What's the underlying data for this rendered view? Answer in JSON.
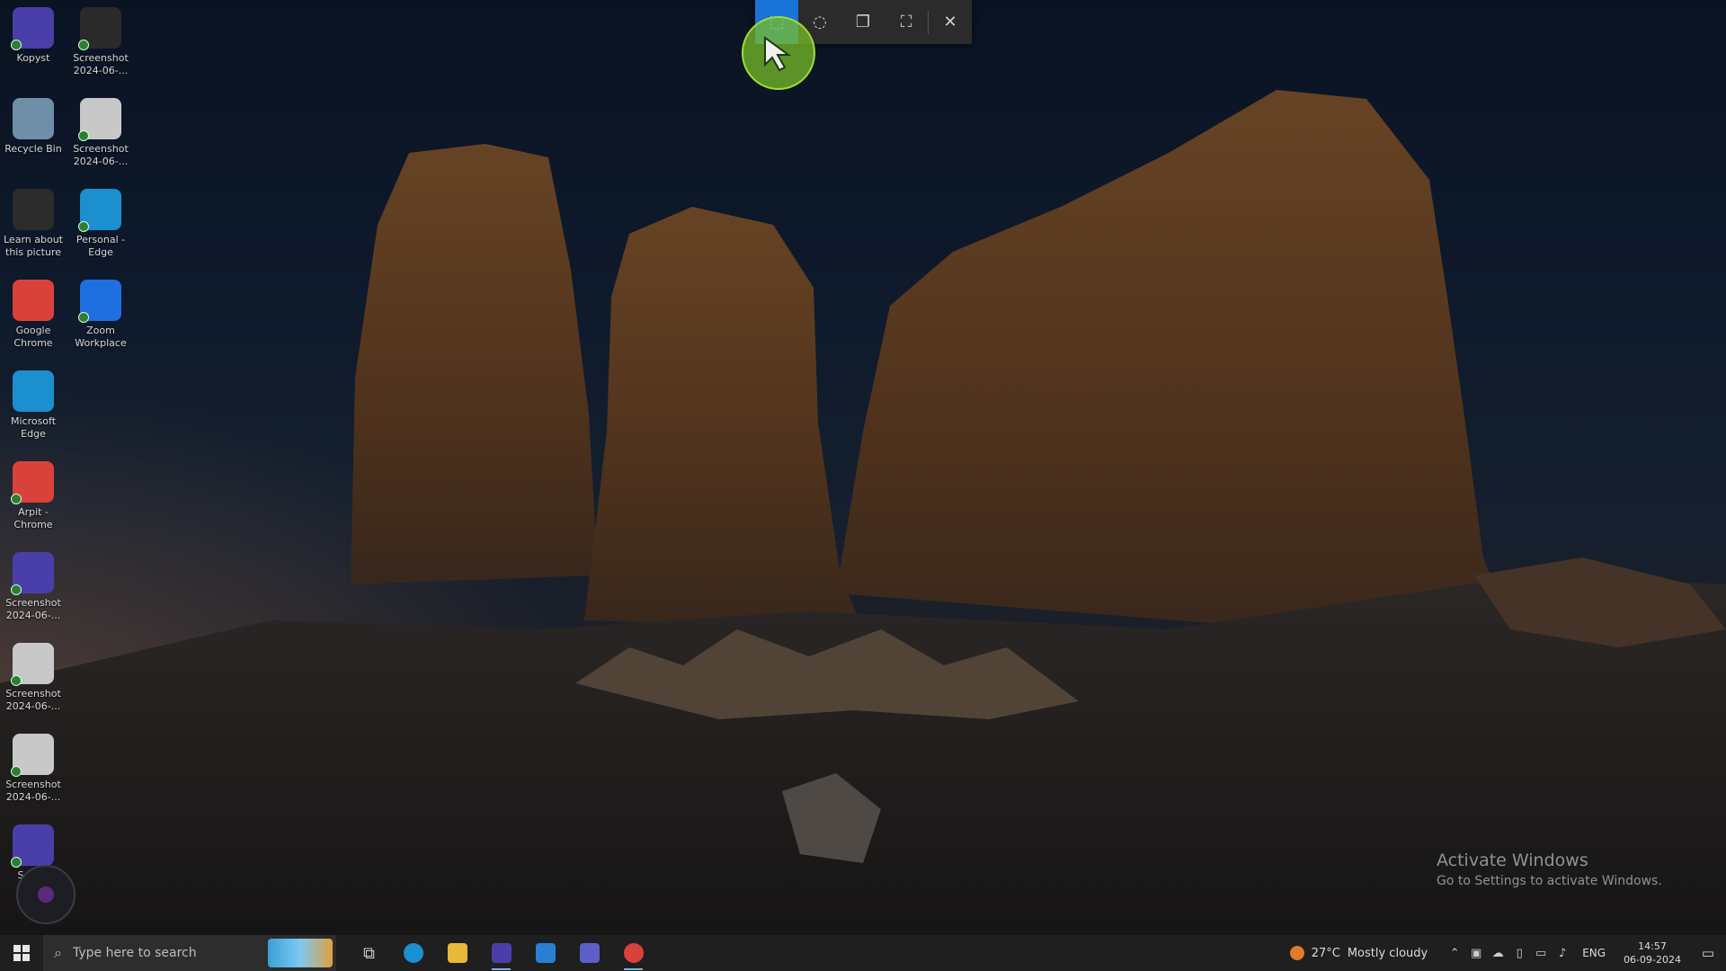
{
  "snip_toolbar": {
    "modes": [
      {
        "name": "rectangular-snip-icon",
        "glyph": "⬚",
        "active": true
      },
      {
        "name": "freeform-snip-icon",
        "glyph": "◌",
        "active": false
      },
      {
        "name": "window-snip-icon",
        "glyph": "❐",
        "active": false
      },
      {
        "name": "fullscreen-snip-icon",
        "glyph": "⛶",
        "active": false
      }
    ],
    "close_glyph": "✕"
  },
  "desktop": {
    "icons": [
      {
        "label": "Kopyst",
        "color": "#4a3fa8",
        "checked": true
      },
      {
        "label": "Screenshot 2024-06-...",
        "color": "#2a2a2a",
        "checked": true
      },
      {
        "label": "Recycle Bin",
        "color": "#6f8ea8",
        "checked": false
      },
      {
        "label": "Screenshot 2024-06-...",
        "color": "#c8c8c8",
        "checked": true
      },
      {
        "label": "Learn about this picture",
        "color": "#2c2c2c",
        "checked": false
      },
      {
        "label": "Personal - Edge",
        "color": "#1c8fcf",
        "checked": true
      },
      {
        "label": "Google Chrome",
        "color": "#d9423a",
        "checked": false
      },
      {
        "label": "Zoom Workplace",
        "color": "#1f6fe0",
        "checked": true
      },
      {
        "label": "Microsoft Edge",
        "color": "#1c8fcf",
        "checked": false
      },
      {
        "label": "Arpit - Chrome",
        "color": "#d9423a",
        "checked": true
      },
      {
        "label": "Screenshot 2024-06-...",
        "color": "#4a3fa8",
        "checked": true
      },
      {
        "label": "Screenshot 2024-06-...",
        "color": "#c8c8c8",
        "checked": true
      },
      {
        "label": "Screenshot 2024-06-...",
        "color": "#c8c8c8",
        "checked": true
      },
      {
        "label": "Scr 20",
        "color": "#4a3fa8",
        "checked": true
      }
    ]
  },
  "watermark": {
    "title": "Activate Windows",
    "subtitle": "Go to Settings to activate Windows."
  },
  "taskbar": {
    "search_placeholder": "Type here to search",
    "apps": [
      {
        "name": "task-view-icon",
        "glyph": "⧉",
        "color": "#cfcfcf",
        "running": false
      },
      {
        "name": "edge-icon",
        "glyph": "",
        "color": "#1c8fcf",
        "running": false
      },
      {
        "name": "file-explorer-icon",
        "glyph": "",
        "color": "#e8b83a",
        "running": false
      },
      {
        "name": "kopyst-icon",
        "glyph": "",
        "color": "#4a3fa8",
        "running": true
      },
      {
        "name": "mail-icon",
        "glyph": "",
        "color": "#2a7fd4",
        "running": false
      },
      {
        "name": "teams-icon",
        "glyph": "",
        "color": "#5b5fc7",
        "running": false
      },
      {
        "name": "chrome-icon",
        "glyph": "",
        "color": "#d9423a",
        "running": true
      }
    ],
    "weather": {
      "temp": "27°C",
      "condition": "Mostly cloudy"
    },
    "lang": "ENG",
    "time": "14:57",
    "date": "06-09-2024"
  }
}
